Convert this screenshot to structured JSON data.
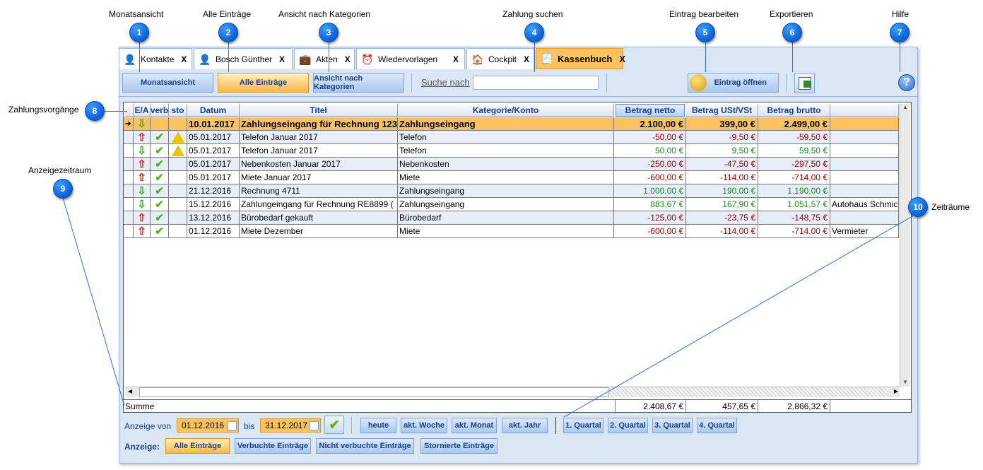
{
  "callouts": [
    {
      "n": "1",
      "label": "Monatsansicht"
    },
    {
      "n": "2",
      "label": "Alle Einträge"
    },
    {
      "n": "3",
      "label": "Ansicht nach Kategorien"
    },
    {
      "n": "4",
      "label": "Zahlung suchen"
    },
    {
      "n": "5",
      "label": "Eintrag bearbeiten"
    },
    {
      "n": "6",
      "label": "Exportieren"
    },
    {
      "n": "7",
      "label": "Hilfe"
    },
    {
      "n": "8",
      "label": "Zahlungsvorgänge"
    },
    {
      "n": "9",
      "label": "Anzeigezeitraum"
    },
    {
      "n": "10",
      "label": "Zeiträume"
    }
  ],
  "tabs": [
    {
      "label": "Kontakte",
      "icon": "person-icon",
      "close": "X"
    },
    {
      "label": "Bosch Günther",
      "icon": "person-icon",
      "close": "X"
    },
    {
      "label": "Akten",
      "icon": "briefcase-icon",
      "close": "X"
    },
    {
      "label": "Wiedervorlagen",
      "icon": "clock-icon",
      "close": "X"
    },
    {
      "label": "Cockpit",
      "icon": "house-icon",
      "close": "X"
    },
    {
      "label": "Kassenbuch",
      "icon": "cashregister-icon",
      "close": "X"
    }
  ],
  "toolbar": {
    "monatsansicht": "Monatsansicht",
    "alle": "Alle Einträge",
    "kategorien": "Ansicht nach Kategorien",
    "suche_label": "Suche nach",
    "suche_value": "",
    "eintrag_oeffnen": "Eintrag öffnen"
  },
  "grid": {
    "headers": [
      "E/A",
      "verb",
      "sto",
      "Datum",
      "Titel",
      "Kategorie/Konto",
      "Betrag netto",
      "Betrag USt/VSt",
      "Betrag brutto"
    ],
    "rows": [
      {
        "ea": "in",
        "verb": false,
        "sto": false,
        "datum": "10.01.2017",
        "titel": "Zahlungseingang für Rechnung 123",
        "kat": "Zahlungseingang",
        "netto": "2.100,00 €",
        "ust": "399,00 €",
        "brutto": "2.499,00 €",
        "extra": "",
        "sign": "pos"
      },
      {
        "ea": "out",
        "verb": true,
        "sto": true,
        "datum": "05.01.2017",
        "titel": "Telefon Januar 2017",
        "kat": "Telefon",
        "netto": "-50,00 €",
        "ust": "-9,50 €",
        "brutto": "-59,50 €",
        "extra": "",
        "sign": "neg"
      },
      {
        "ea": "in",
        "verb": true,
        "sto": true,
        "datum": "05.01.2017",
        "titel": "Telefon Januar 2017",
        "kat": "Telefon",
        "netto": "50,00 €",
        "ust": "9,50 €",
        "brutto": "59,50 €",
        "extra": "",
        "sign": "pos"
      },
      {
        "ea": "out",
        "verb": true,
        "sto": false,
        "datum": "05.01.2017",
        "titel": "Nebenkosten Januar 2017",
        "kat": "Nebenkosten",
        "netto": "-250,00 €",
        "ust": "-47,50 €",
        "brutto": "-297,50 €",
        "extra": "",
        "sign": "neg"
      },
      {
        "ea": "out",
        "verb": true,
        "sto": false,
        "datum": "05.01.2017",
        "titel": "Miete Januar 2017",
        "kat": "Miete",
        "netto": "-600,00 €",
        "ust": "-114,00 €",
        "brutto": "-714,00 €",
        "extra": "",
        "sign": "neg"
      },
      {
        "ea": "in",
        "verb": true,
        "sto": false,
        "datum": "21.12.2016",
        "titel": "Rechnung 4711",
        "kat": "Zahlungseingang",
        "netto": "1.000,00 €",
        "ust": "190,00 €",
        "brutto": "1.190,00 €",
        "extra": "",
        "sign": "pos"
      },
      {
        "ea": "in",
        "verb": true,
        "sto": false,
        "datum": "15.12.2016",
        "titel": "Zahlungeingang für Rechnung RE8899 (",
        "kat": "Zahlungseingang",
        "netto": "883,67 €",
        "ust": "167,90 €",
        "brutto": "1.051,57 €",
        "extra": "Autohaus Schmic",
        "sign": "pos"
      },
      {
        "ea": "out",
        "verb": true,
        "sto": false,
        "datum": "13.12.2016",
        "titel": "Bürobedarf gekauft",
        "kat": "Bürobedarf",
        "netto": "-125,00 €",
        "ust": "-23,75 €",
        "brutto": "-148,75 €",
        "extra": "",
        "sign": "neg"
      },
      {
        "ea": "out",
        "verb": true,
        "sto": false,
        "datum": "01.12.2016",
        "titel": "Miete Dezember",
        "kat": "Miete",
        "netto": "-600,00 €",
        "ust": "-114,00 €",
        "brutto": "-714,00 €",
        "extra": "Vermieter",
        "sign": "neg"
      }
    ],
    "summe_label": "Summe",
    "summe_netto": "2.408,67 €",
    "summe_ust": "457,65 €",
    "summe_brutto": "2.866,32 €"
  },
  "zeitraum": {
    "von_label": "Anzeige von",
    "von": "01.12.2016",
    "bis_label": "bis",
    "bis": "31.12.2017",
    "buttons": [
      "heute",
      "akt. Woche",
      "akt. Monat",
      "akt. Jahr",
      "1. Quartal",
      "2. Quartal",
      "3. Quartal",
      "4. Quartal"
    ]
  },
  "anzeige": {
    "label": "Anzeige:",
    "buttons": [
      "Alle Einträge",
      "Verbuchte Einträge",
      "Nicht verbuchte Einträge",
      "Stornierte Einträge"
    ]
  }
}
